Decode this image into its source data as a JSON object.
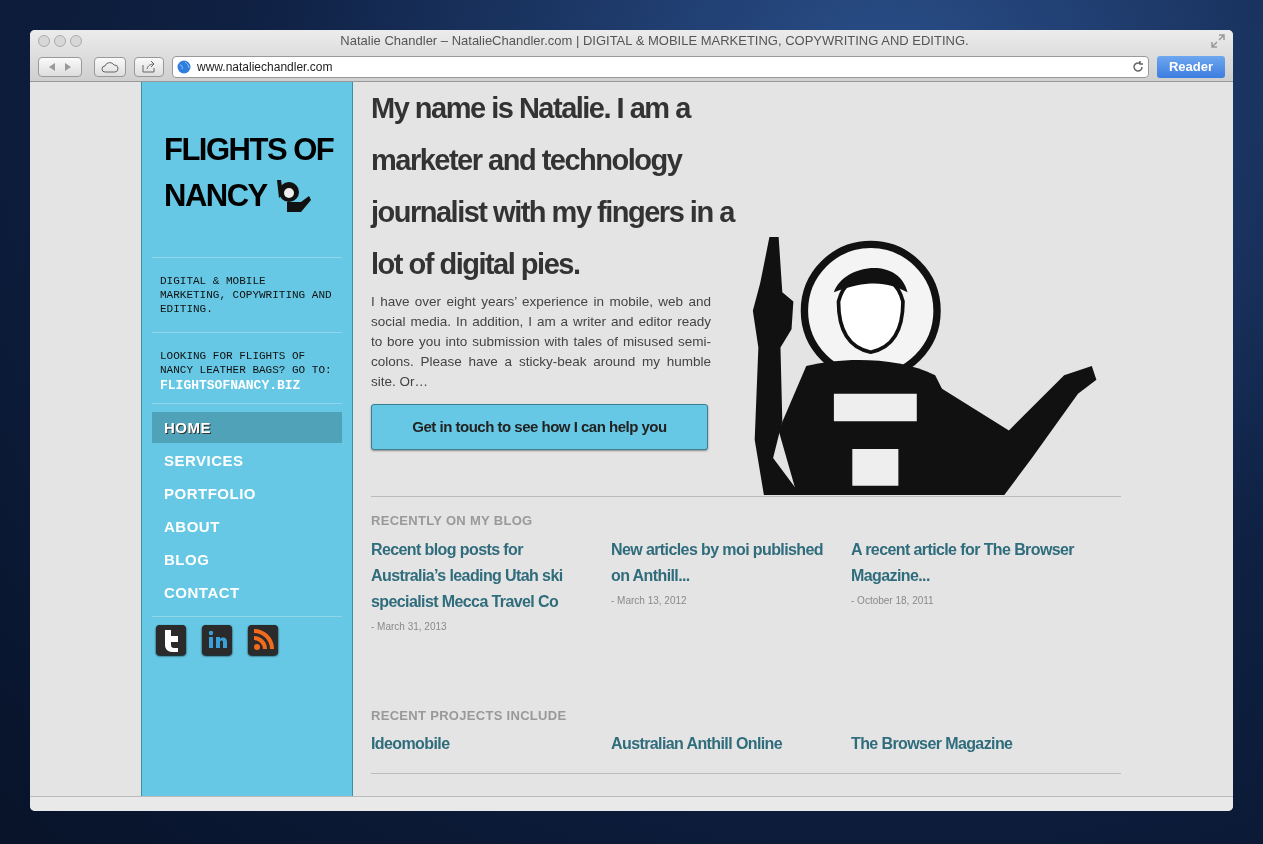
{
  "browser": {
    "title": "Natalie Chandler – NatalieChandler.com | DIGITAL & MOBILE MARKETING, COPYWRITING AND EDITING.",
    "url": "www.nataliechandler.com",
    "reader_button": "Reader"
  },
  "sidebar": {
    "logo_lines": [
      "FLIGHTS OF",
      "NANCY"
    ],
    "tagline": "DIGITAL & MOBILE MARKETING, COPYWRITING AND EDITING.",
    "promo_text": "LOOKING FOR FLIGHTS OF NANCY LEATHER BAGS? GO TO:",
    "promo_link": "FLIGHTSOFNANCY.BIZ",
    "nav": [
      {
        "label": "HOME",
        "selected": true
      },
      {
        "label": "SERVICES",
        "selected": false
      },
      {
        "label": "PORTFOLIO",
        "selected": false
      },
      {
        "label": "ABOUT",
        "selected": false
      },
      {
        "label": "BLOG",
        "selected": false
      },
      {
        "label": "CONTACT",
        "selected": false
      }
    ],
    "social": [
      {
        "kind": "twitter"
      },
      {
        "kind": "linkedin"
      },
      {
        "kind": "rss"
      }
    ]
  },
  "main": {
    "headline": "My name is Natalie. I am a marketer and technology journalist with my fingers in a lot of digital pies.",
    "intro": "I have over eight years’ experience in mobile, web and social media. In addition, I am a writer and editor ready to bore you into submission with tales of misused semi-colons. Please have a sticky-beak around my humble site. Or…",
    "cta_button": "Get in touch to see how I can help you",
    "blog": {
      "heading": "RECENTLY ON MY BLOG",
      "posts": [
        {
          "title": "Recent blog posts for Australia’s leading Utah ski specialist Mecca Travel Co",
          "date": "- March 31, 2013"
        },
        {
          "title": "New articles by moi published on Anthill...",
          "date": "- March 13, 2012"
        },
        {
          "title": "A recent article for The Browser Magazine...",
          "date": "- October 18, 2011"
        }
      ]
    },
    "projects": {
      "heading": "RECENT PROJECTS INCLUDE",
      "items": [
        "Ideomobile",
        "Australian Anthill Online",
        "The Browser Magazine"
      ]
    }
  }
}
